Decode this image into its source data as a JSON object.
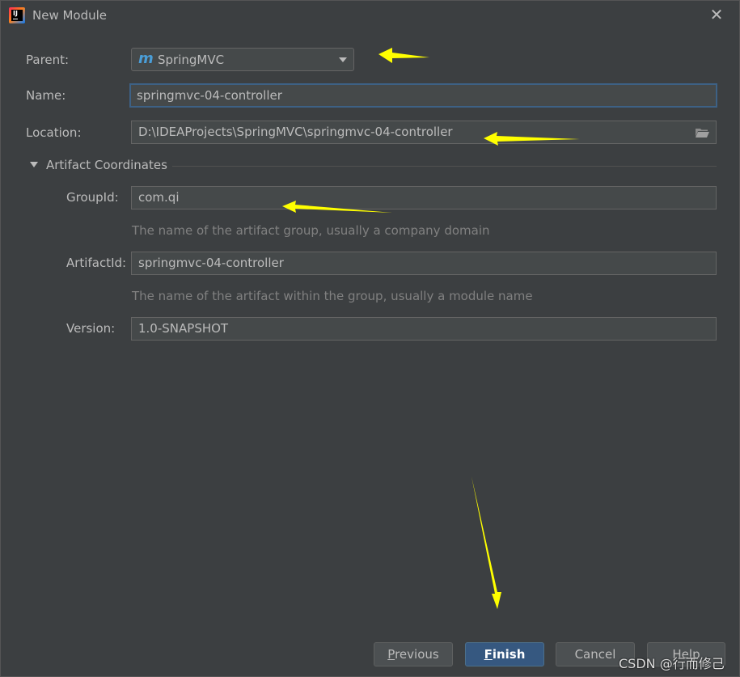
{
  "window": {
    "title": "New Module",
    "close_glyph": "✕"
  },
  "form": {
    "parent": {
      "label": "Parent:",
      "value": "SpringMVC",
      "logo": "m"
    },
    "name": {
      "label": "Name:",
      "value": "springmvc-04-controller"
    },
    "location": {
      "label": "Location:",
      "value": "D:\\IDEAProjects\\SpringMVC\\springmvc-04-controller"
    },
    "artifact_section": {
      "label": "Artifact Coordinates"
    },
    "group_id": {
      "label": "GroupId:",
      "value": "com.qi",
      "hint": "The name of the artifact group, usually a company domain"
    },
    "artifact_id": {
      "label": "ArtifactId:",
      "value": "springmvc-04-controller",
      "hint": "The name of the artifact within the group, usually a module name"
    },
    "version": {
      "label": "Version:",
      "value": "1.0-SNAPSHOT"
    }
  },
  "buttons": {
    "previous": {
      "mnemonic": "P",
      "rest": "revious"
    },
    "finish": {
      "mnemonic": "F",
      "rest": "inish"
    },
    "cancel": {
      "label": "Cancel"
    },
    "help": {
      "label": "Help"
    }
  },
  "watermark": "CSDN @行而修己",
  "icons": {
    "app": "intellij-idea-icon",
    "folder": "folder-open-icon",
    "caret": "chevron-down-icon",
    "annotation": "yellow-arrow"
  },
  "colors": {
    "background": "#3c3f41",
    "field": "#45494a",
    "focus": "#3d6185",
    "primary_button": "#365880",
    "maven_logo": "#4a9ed8",
    "annotation_arrow": "#ffff00"
  }
}
